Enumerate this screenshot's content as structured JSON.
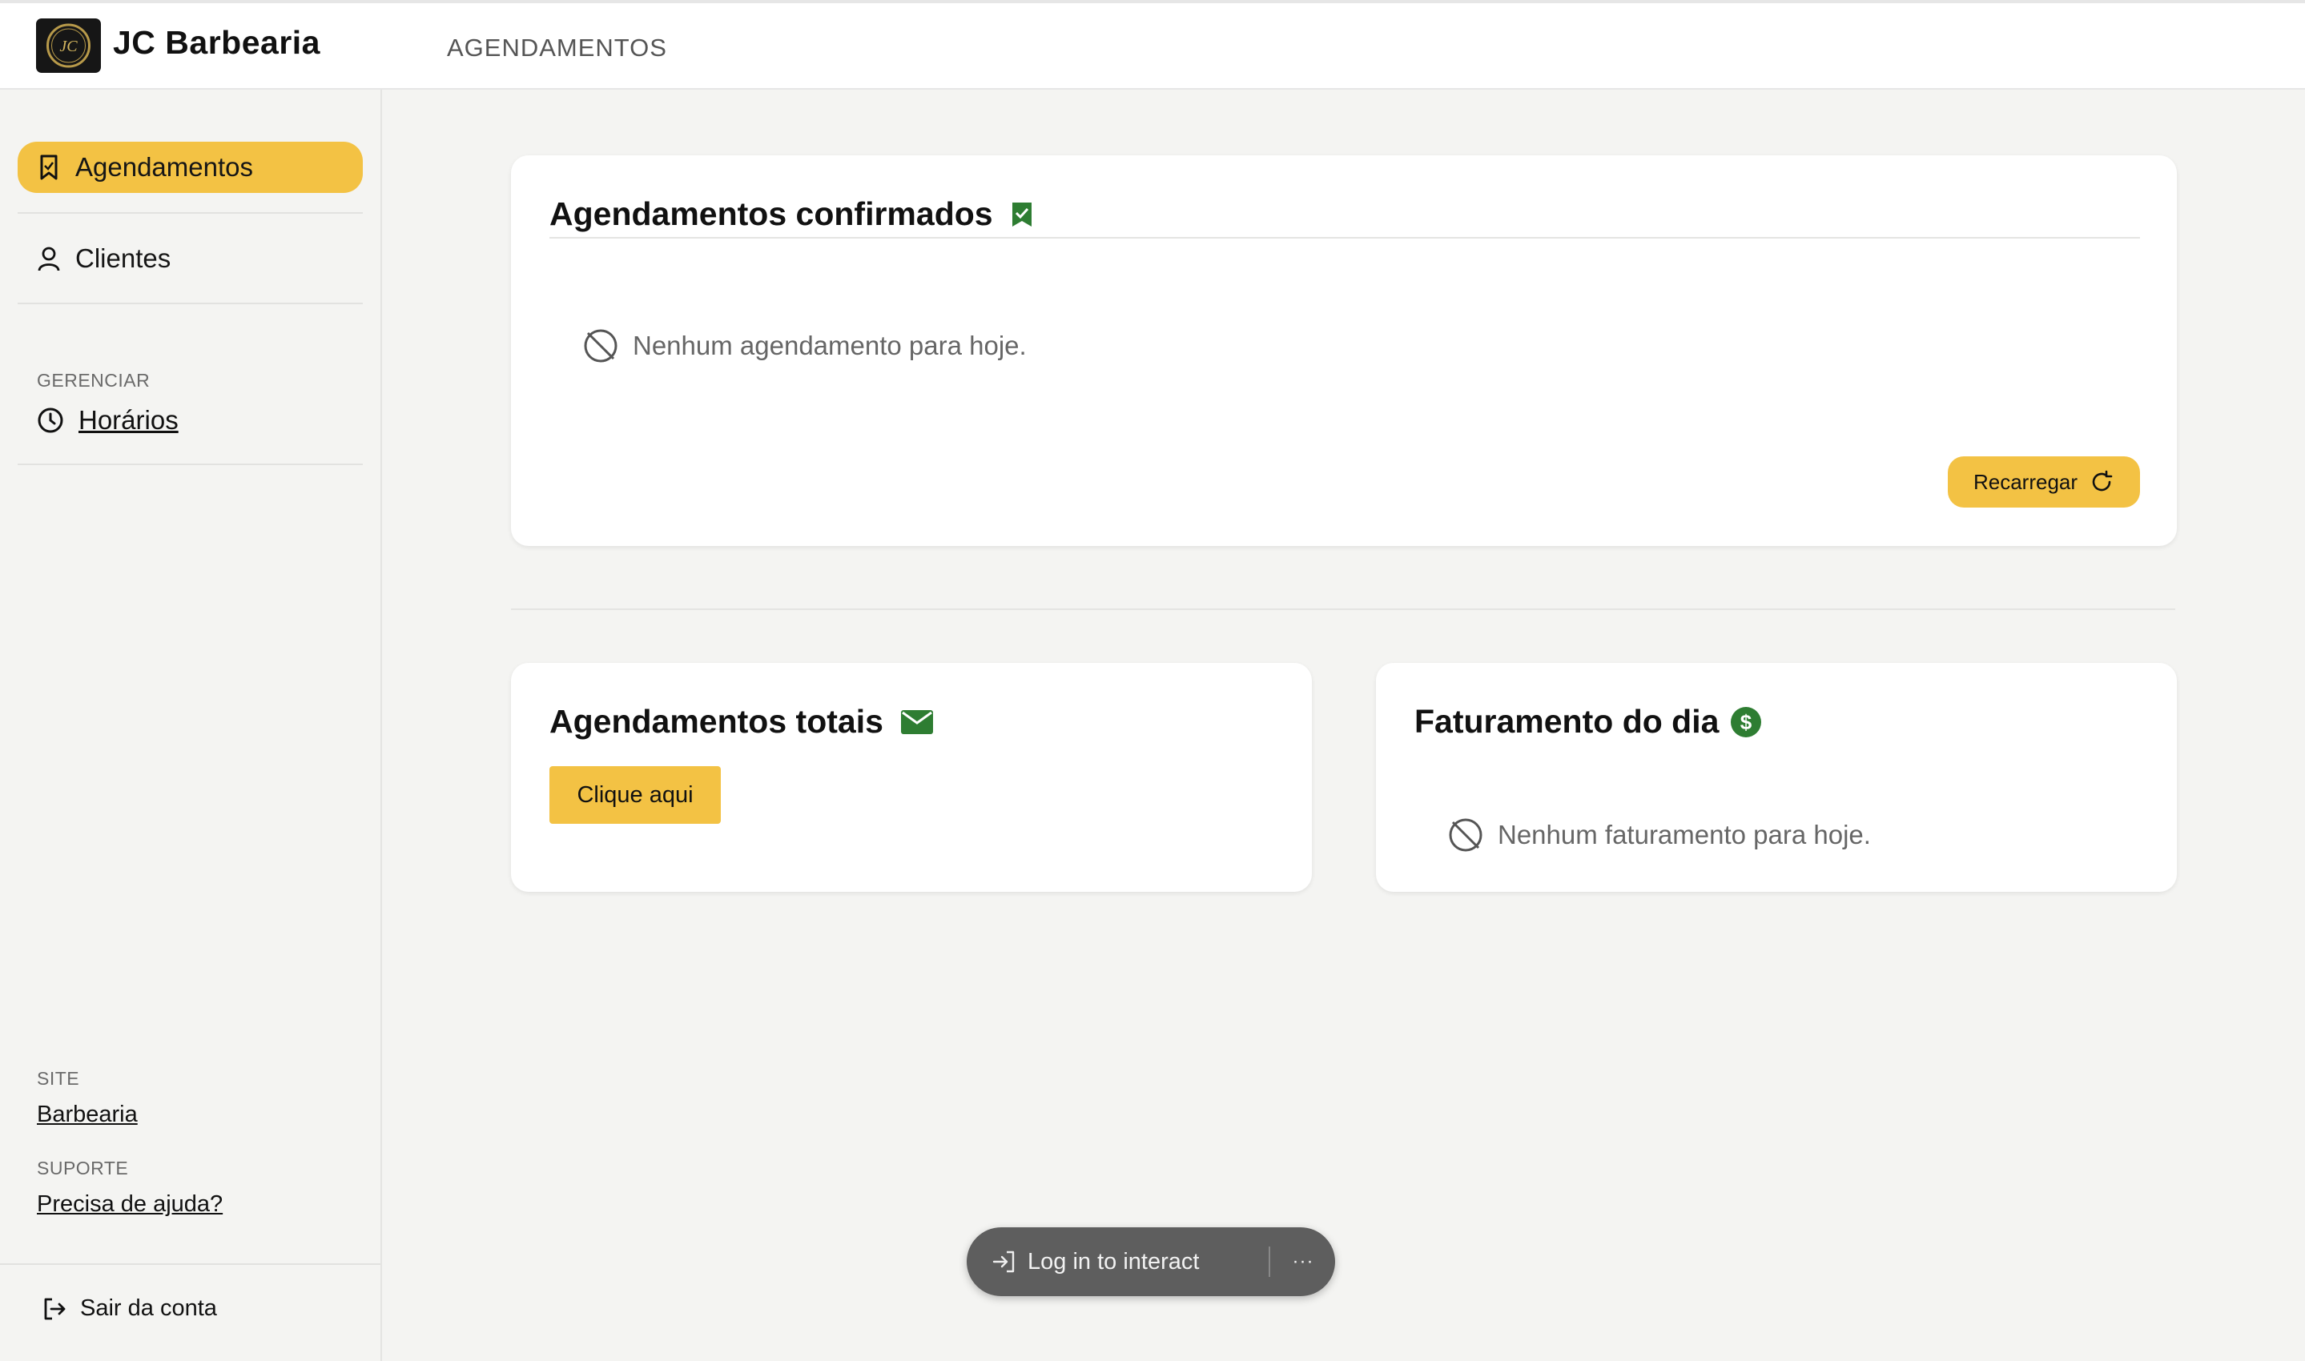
{
  "brand": {
    "name": "JC Barbearia",
    "logo_text": "JC"
  },
  "header": {
    "title": "AGENDAMENTOS"
  },
  "sidebar": {
    "items": [
      {
        "label": "Agendamentos",
        "icon": "bookmark-icon",
        "active": true
      },
      {
        "label": "Clientes",
        "icon": "user-icon",
        "active": false
      }
    ],
    "manage": {
      "section": "GERENCIAR",
      "item": "Horários",
      "icon": "clock-icon"
    },
    "site": {
      "section": "SITE",
      "link": "Barbearia"
    },
    "support": {
      "section": "SUPORTE",
      "link": "Precisa de ajuda?"
    },
    "logout": {
      "label": "Sair da conta",
      "icon": "logout-icon"
    }
  },
  "confirmed": {
    "title": "Agendamentos confirmados",
    "empty": "Nenhum agendamento para hoje.",
    "reload_label": "Recarregar"
  },
  "totals": {
    "title": "Agendamentos totais",
    "button_label": "Clique aqui"
  },
  "revenue": {
    "title": "Faturamento do dia",
    "empty": "Nenhum faturamento para hoje."
  },
  "floating": {
    "login_label": "Log in to interact",
    "more_label": "···"
  },
  "colors": {
    "accent": "#f3c244",
    "green": "#2e7d32",
    "dark": "#161616"
  }
}
